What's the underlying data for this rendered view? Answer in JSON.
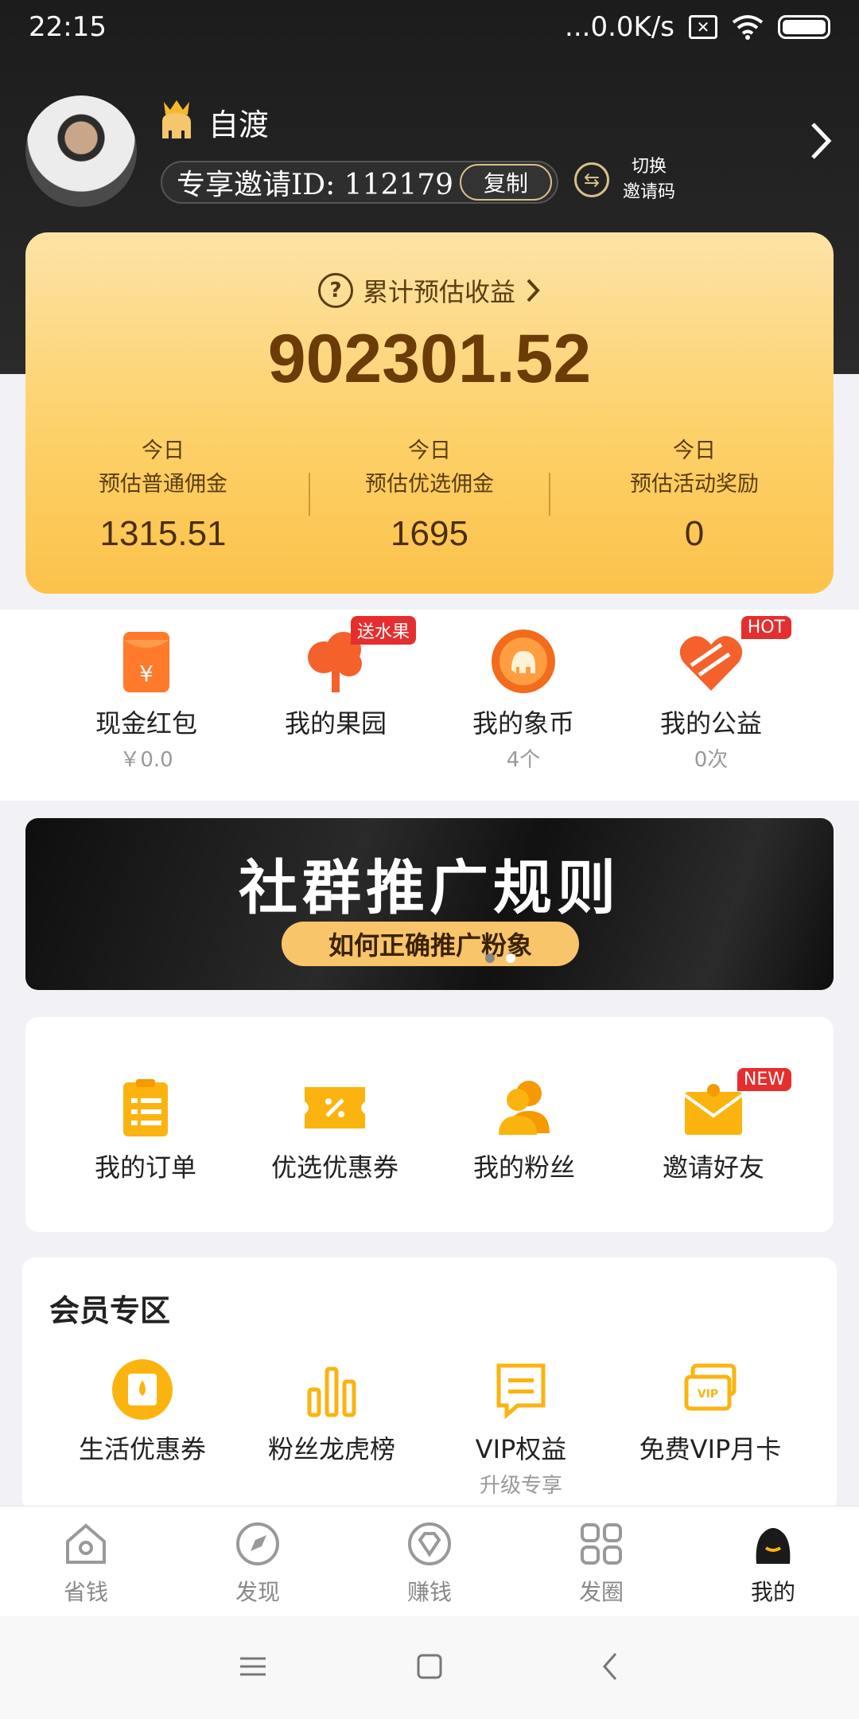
{
  "status": {
    "time": "22:15",
    "network": "...0.0K/s"
  },
  "profile": {
    "username": "自渡",
    "invite_label": "专享邀请ID: 112179",
    "copy_label": "复制",
    "switch_label_1": "切换",
    "switch_label_2": "邀请码"
  },
  "earnings": {
    "title": "累计预估收益",
    "total": "902301.52",
    "columns": [
      {
        "line1": "今日",
        "line2": "预估普通佣金",
        "value": "1315.51"
      },
      {
        "line1": "今日",
        "line2": "预估优选佣金",
        "value": "1695"
      },
      {
        "line1": "今日",
        "line2": "预估活动奖励",
        "value": "0"
      }
    ]
  },
  "quick_actions": [
    {
      "label": "现金红包",
      "sub": "￥0.0",
      "tag": ""
    },
    {
      "label": "我的果园",
      "sub": "",
      "tag": "送水果"
    },
    {
      "label": "我的象币",
      "sub": "4个",
      "tag": ""
    },
    {
      "label": "我的公益",
      "sub": "0次",
      "tag": "HOT"
    }
  ],
  "banner": {
    "title": "社群推广规则",
    "subtitle": "如何正确推广粉象"
  },
  "menu": [
    {
      "label": "我的订单",
      "tag": ""
    },
    {
      "label": "优选优惠券",
      "tag": ""
    },
    {
      "label": "我的粉丝",
      "tag": ""
    },
    {
      "label": "邀请好友",
      "tag": "NEW"
    }
  ],
  "member": {
    "title": "会员专区",
    "items": [
      {
        "label": "生活优惠券",
        "sub": ""
      },
      {
        "label": "粉丝龙虎榜",
        "sub": ""
      },
      {
        "label": "VIP权益",
        "sub": "升级专享"
      },
      {
        "label": "免费VIP月卡",
        "sub": ""
      }
    ]
  },
  "nav": [
    {
      "label": "省钱",
      "icon": "home-icon"
    },
    {
      "label": "发现",
      "icon": "compass-icon"
    },
    {
      "label": "赚钱",
      "icon": "diamond-icon"
    },
    {
      "label": "发圈",
      "icon": "grid-icon"
    },
    {
      "label": "我的",
      "icon": "profile-icon",
      "active": true
    }
  ],
  "colors": {
    "accent": "#fcc24a",
    "brand_dark": "#1c1c1c",
    "tag_red": "#e62e2e",
    "icon_yellow": "#fbb40f"
  }
}
